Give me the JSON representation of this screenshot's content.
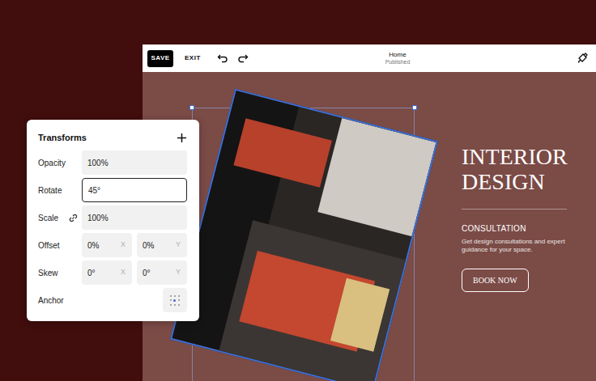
{
  "toolbar": {
    "save": "SAVE",
    "exit": "EXIT",
    "page_title": "Home",
    "page_status": "Published"
  },
  "hero": {
    "heading": "INTERIOR DESIGN",
    "subheading": "CONSULTATION",
    "description": "Get design consultations and expert guidance for your space.",
    "button": "BOOK NOW"
  },
  "transforms": {
    "title": "Transforms",
    "rows": [
      {
        "label": "Opacity",
        "kind": "field",
        "focused": false,
        "value": "100%"
      },
      {
        "label": "Rotate",
        "kind": "field",
        "focused": true,
        "value": "45°"
      },
      {
        "label": "Scale",
        "kind": "linked",
        "focused": false,
        "value": "100%"
      },
      {
        "label": "Offset",
        "kind": "pair",
        "focused": false,
        "fields": [
          {
            "value": "0%",
            "axis": "X"
          },
          {
            "value": "0%",
            "axis": "Y"
          }
        ]
      },
      {
        "label": "Skew",
        "kind": "pair",
        "focused": false,
        "fields": [
          {
            "value": "0°",
            "axis": "X"
          },
          {
            "value": "0°",
            "axis": "Y"
          }
        ]
      },
      {
        "label": "Anchor",
        "kind": "anchor",
        "focused": false
      }
    ]
  }
}
